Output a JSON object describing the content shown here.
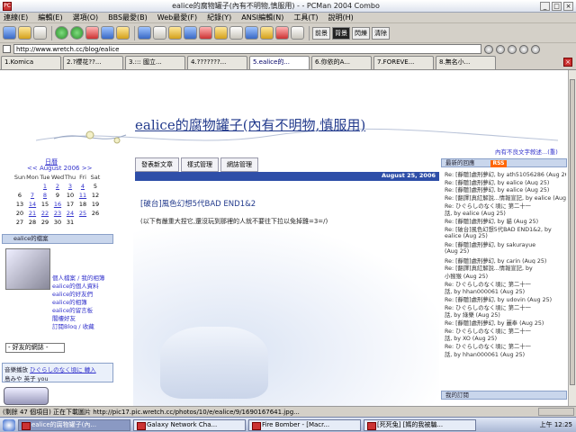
{
  "window": {
    "title": "ealice的腐物罐子(內有不明物,慎服用) - - PCMan 2004 Combo",
    "app_icon": "PC"
  },
  "menu": [
    "連線(E)",
    "編輯(E)",
    "選項(O)",
    "BBS最愛(B)",
    "Web最愛(F)",
    "紀錄(Y)",
    "ANSI編輯(N)",
    "工具(T)",
    "說明(H)"
  ],
  "toolbar": {
    "text_buttons": [
      "前景",
      "背景",
      "閃爍",
      "清除"
    ]
  },
  "address": {
    "value": "http://www.wretch.cc/blog/ealice"
  },
  "tabs": [
    "1.Komica",
    "2.?櫻花??...",
    "3.::: 國立...",
    "4.???????...",
    "5.ealice的...",
    "6.你依的A...",
    "7.FOREVE...",
    "8.無名小..."
  ],
  "page": {
    "blog_title": "ealice的腐物罐子(內有不明物,慎服用)",
    "calendar": {
      "title": "日曆",
      "month": "<< August 2006 >>",
      "weekdays": [
        "Sun",
        "Mon",
        "Tue",
        "Wed",
        "Thu",
        "Fri",
        "Sat"
      ],
      "rows": [
        [
          "",
          "",
          "1",
          "2",
          "3",
          "4",
          "5"
        ],
        [
          "6",
          "7",
          "8",
          "9",
          "10",
          "11",
          "12"
        ],
        [
          "13",
          "14",
          "15",
          "16",
          "17",
          "18",
          "19"
        ],
        [
          "20",
          "21",
          "22",
          "23",
          "24",
          "25",
          "26"
        ],
        [
          "27",
          "28",
          "29",
          "30",
          "31",
          "",
          ""
        ]
      ]
    },
    "side_box_1": "ealice的檔案",
    "side_links": [
      "個人檔案 / 我的相簿",
      "ealice的個人資料",
      "ealice的好友們",
      "ealice的相簿",
      "ealice的留言板",
      "閣樓好友",
      "訂閱Blog / 收藏"
    ],
    "side_select": "- 好友的網誌 -",
    "music": {
      "label": "音樂播放",
      "song": "ひぐらしのなく頃に 轉入",
      "artist": "島みや 英子 you"
    },
    "main_tabs": [
      "發表新文章",
      "樣式管理",
      "網誌管理"
    ],
    "date": "August 25, 2006",
    "post_title": "[破台]風色幻想5代BAD END1&2",
    "post_body": "(以下有嚴重大捏它,還沒玩到那裡的人就不要往下拉以免掉雞=3=/)",
    "right_note": "內有不良文字敘述...(重)",
    "right_head": "最新的回應",
    "rss": "RSS",
    "comments": [
      "Re: [靜聽]處刑夢幻, by ath51056286 (Aug 26)",
      "Re: [靜聽]處刑夢幻, by ealice (Aug 25)",
      "Re: [靜聽]處刑夢幻, by ealice (Aug 25)",
      "Re: [翻譯]真紅解說...情報宣記, by ealice (Aug 25)",
      "Re: ひぐらしのなく頃に 第二十一",
      "話, by ealice (Aug 25)",
      "Re: [靜聽]處刑夢幻, by 貓 (Aug 25)",
      "Re: [破台]風色幻想5代BAD END1&2, by",
      "ealice (Aug 25)",
      "Re: [靜聽]處刑夢幻, by sakurayue",
      "(Aug 25)",
      "Re: [靜聽]處刑夢幻, by carin (Aug 25)",
      "Re: [翻譯]真紅解說...情報宣記, by",
      "小猴猴 (Aug 25)",
      "Re: ひぐらしのなく頃に 第二十一",
      "話, by hhan000061 (Aug 25)",
      "Re: [靜聽]處刑夢幻, by udovin (Aug 25)",
      "Re: ひぐらしのなく頃に 第二十一",
      "話, by 綠樂 (Aug 25)",
      "Re: [靜聽]處刑夢幻, by 麗奉 (Aug 25)",
      "Re: ひぐらしのなく頃に 第二十一",
      "話, by XO (Aug 25)",
      "Re: ひぐらしのなく頃に 第二十一",
      "話, by hhan000061 (Aug 25)"
    ],
    "right_foot": "我的訂閱"
  },
  "status": {
    "text": "(剩餘 47 個項目) 正在下載圖片 http://pic17.pic.wretch.cc/photos/10/e/ealice/9/1690167641.jpg..."
  },
  "taskbar": {
    "tasks": [
      "ealice的腐物罐子(內...",
      "Galaxy Network Cha...",
      "Fire Bomber - [Macr...",
      "[死死兔] [媽的我被騙..."
    ],
    "clock": "上午 12:25"
  }
}
